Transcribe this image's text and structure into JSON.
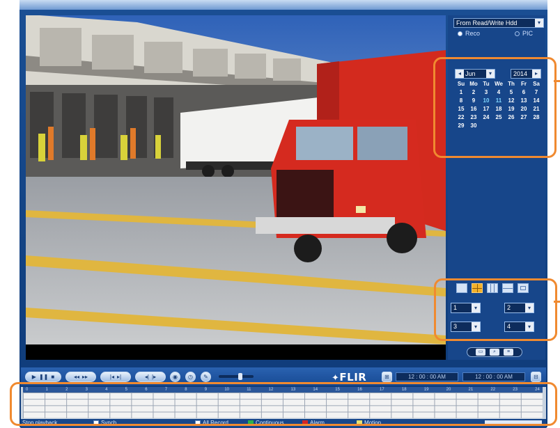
{
  "store_panel": {
    "storage_select": "From Read/Write Hdd",
    "radio_record": "Reco",
    "radio_picture": "PIC"
  },
  "calendar": {
    "month": "Jun",
    "year": "2014",
    "weekday_headers": [
      "Su",
      "Mo",
      "Tu",
      "We",
      "Th",
      "Fr",
      "Sa"
    ],
    "weeks": [
      [
        "1",
        "2",
        "3",
        "4",
        "5",
        "6",
        "7"
      ],
      [
        "8",
        "9",
        "10",
        "11",
        "12",
        "13",
        "14"
      ],
      [
        "15",
        "16",
        "17",
        "18",
        "19",
        "20",
        "21"
      ],
      [
        "22",
        "23",
        "24",
        "25",
        "26",
        "27",
        "28"
      ],
      [
        "29",
        "30",
        "",
        "",
        "",
        "",
        ""
      ]
    ]
  },
  "channels": {
    "ch1": "1",
    "ch2": "2",
    "ch3": "3",
    "ch4": "4"
  },
  "controlbar": {
    "brand": "FLIR",
    "start_time": "12 : 00 : 00 AM",
    "end_time": "12 : 00 : 00 AM"
  },
  "timeline": {
    "hours": [
      "0",
      "1",
      "2",
      "3",
      "4",
      "5",
      "6",
      "7",
      "8",
      "9",
      "10",
      "11",
      "12",
      "13",
      "14",
      "15",
      "16",
      "17",
      "18",
      "19",
      "20",
      "21",
      "22",
      "23",
      "24"
    ]
  },
  "legend": {
    "stop_playback": "Stop playback",
    "synch": "Synch",
    "all_record": "All Record",
    "continuous": "Continuous",
    "alarm": "Alarm",
    "motion": "Motion",
    "colors": {
      "continuous": "#2bb34a",
      "alarm": "#d42525",
      "motion": "#e8e070",
      "highlight": "#f08a30"
    }
  }
}
